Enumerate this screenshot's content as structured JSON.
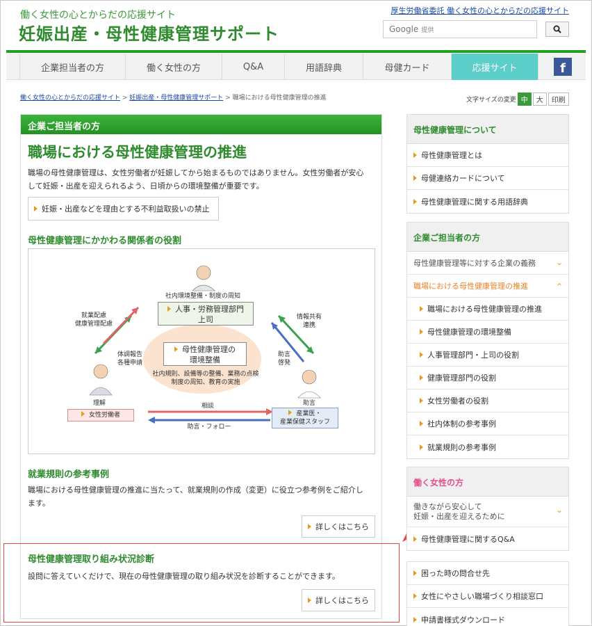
{
  "header": {
    "tagline": "働く女性の心とからだの応援サイト",
    "title": "妊娠出産・母性健康管理サポート",
    "top_link": "厚生労働省委託 働く女性の心とからだの応援サイト",
    "search_brand": "Google",
    "search_provider": "提供"
  },
  "nav": {
    "items": [
      "企業担当者の方",
      "働く女性の方",
      "Q&A",
      "用語辞典",
      "母健カード",
      "応援サイト"
    ],
    "facebook": "f"
  },
  "breadcrumb": {
    "links": [
      "働く女性の心とからだの応援サイト",
      "妊娠出産・母性健康管理サポート"
    ],
    "current": "職場における母性健康管理の推進"
  },
  "font_size": {
    "label": "文字サイズの変更",
    "medium": "中",
    "large": "大",
    "print": "印刷"
  },
  "main": {
    "section_label": "企業ご担当者の方",
    "heading": "職場における母性健康管理の推進",
    "intro_line1": "職場の母性健康管理は、女性労働者が妊娠してから始まるものではありません。女性労働者が安心",
    "intro_line2": "して妊娠・出産を迎えられるよう、日頃からの環境整備が重要です。",
    "prohibition_link": "妊娠・出産などを理由とする不利益取扱いの禁止",
    "roles_heading": "母性健康管理にかかわる関係者の役割",
    "diagram": {
      "top_caption": "社内環境整備・制度の周知",
      "hr_label": "人事・労務管理部門",
      "hr_sub": "上司",
      "left_caption1": "就業配慮",
      "left_caption2": "健康管理配慮",
      "report1": "体調報告",
      "report2": "各種申請",
      "right_caption1": "情報共有",
      "right_caption2": "連携",
      "guidance1": "助言",
      "guidance2": "啓発",
      "center_title1": "母性健康管理の",
      "center_title2": "環境整備",
      "center_desc1": "社内規則、設備等の整備、業務の点検",
      "center_desc2": "制度の周知、教育の実施",
      "understand": "理解",
      "worker_label": "女性労働者",
      "consult": "相談",
      "advice": "助言",
      "advice_follow": "助言・フォロー",
      "doctor_label1": "産業医・",
      "doctor_label2": "産業保健スタッフ"
    },
    "rules_heading": "就業規則の参考事例",
    "rules_line1": "職場における母性健康管理の推進に当たって、就業規則の作成（変更）に役立つ参考例をご紹介し",
    "rules_line2": "ます。",
    "more_label": "詳しくはこちら",
    "diagnosis_heading": "母性健康管理取り組み状況診断",
    "diagnosis_text": "設問に答えていくだけで、現在の母性健康管理の取り組み状況を診断することができます。",
    "more_label2": "詳しくはこちら"
  },
  "sidebar": {
    "box1": {
      "heading": "母性健康管理について",
      "items": [
        "母性健康管理とは",
        "母健連絡カードについて",
        "母性健康管理に関する用語辞典"
      ]
    },
    "box2": {
      "heading": "企業ご担当者の方",
      "parent1": "母性健康管理等に対する企業の義務",
      "parent2": "職場における母性健康管理の推進",
      "items": [
        "職場における母性健康管理の推進",
        "母性健康管理の環境整備",
        "人事管理部門・上司の役割",
        "健康管理部門の役割",
        "女性労働者の役割",
        "社内体制の参考事例",
        "就業規則の参考事例"
      ]
    },
    "box3": {
      "heading": "働く女性の方",
      "parent_line1": "働きながら安心して",
      "parent_line2": "妊娠・出産を迎えるために",
      "items": [
        "母性健康管理に関するQ&A"
      ]
    },
    "box4": {
      "items": [
        "困った時の問合せ先",
        "女性にやさしい職場づくり相談窓口",
        "申請書様式ダウンロード"
      ]
    }
  }
}
